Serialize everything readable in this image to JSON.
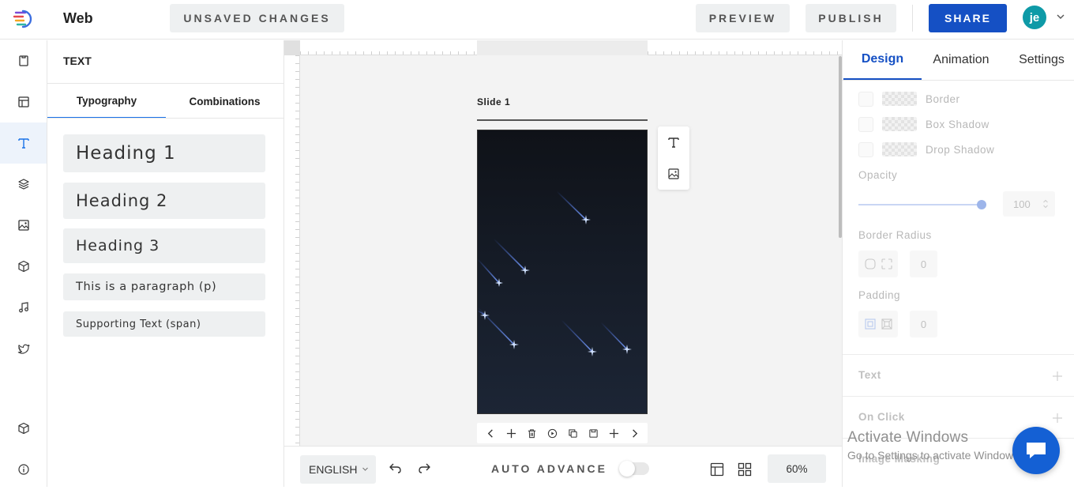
{
  "header": {
    "app_title": "Web",
    "unsaved_label": "UNSAVED CHANGES",
    "preview_label": "PREVIEW",
    "publish_label": "PUBLISH",
    "share_label": "SHARE",
    "avatar_initials": "je"
  },
  "left_rail": {
    "items": [
      "page-icon",
      "layout-icon",
      "text-icon",
      "layers-icon",
      "image-icon",
      "cube-icon",
      "music-icon",
      "twitter-icon",
      "package-icon",
      "info-icon"
    ],
    "active": "text-icon"
  },
  "text_panel": {
    "title": "TEXT",
    "tabs": [
      "Typography",
      "Combinations"
    ],
    "active_tab": "Typography",
    "styles": [
      "Heading 1",
      "Heading 2",
      "Heading 3",
      "This is a paragraph (p)",
      "Supporting Text (span)"
    ]
  },
  "canvas": {
    "slide_label": "Slide 1",
    "float_tools": [
      "text-tool-icon",
      "image-tool-icon"
    ],
    "slide_tools": [
      "prev-icon",
      "add-icon",
      "delete-icon",
      "play-icon",
      "duplicate-icon",
      "save-icon",
      "add-after-icon",
      "next-icon"
    ],
    "slide_bg_color": "#151b26"
  },
  "bottom_bar": {
    "language": "ENGLISH",
    "auto_advance_label": "AUTO ADVANCE",
    "auto_advance_on": false,
    "zoom": "60%"
  },
  "right_panel": {
    "tabs": [
      "Design",
      "Animation",
      "Settings"
    ],
    "active_tab": "Design",
    "effects": [
      "Border",
      "Box Shadow",
      "Drop Shadow"
    ],
    "opacity_label": "Opacity",
    "opacity_value": "100",
    "border_radius_label": "Border Radius",
    "border_radius_value": "0",
    "padding_label": "Padding",
    "padding_value": "0",
    "sections": [
      "Text",
      "On Click",
      "Image Masking"
    ],
    "accent_color": "#1550c4"
  },
  "system": {
    "watermark_title": "Activate Windows",
    "watermark_sub": "Go to Settings to activate Windows."
  }
}
